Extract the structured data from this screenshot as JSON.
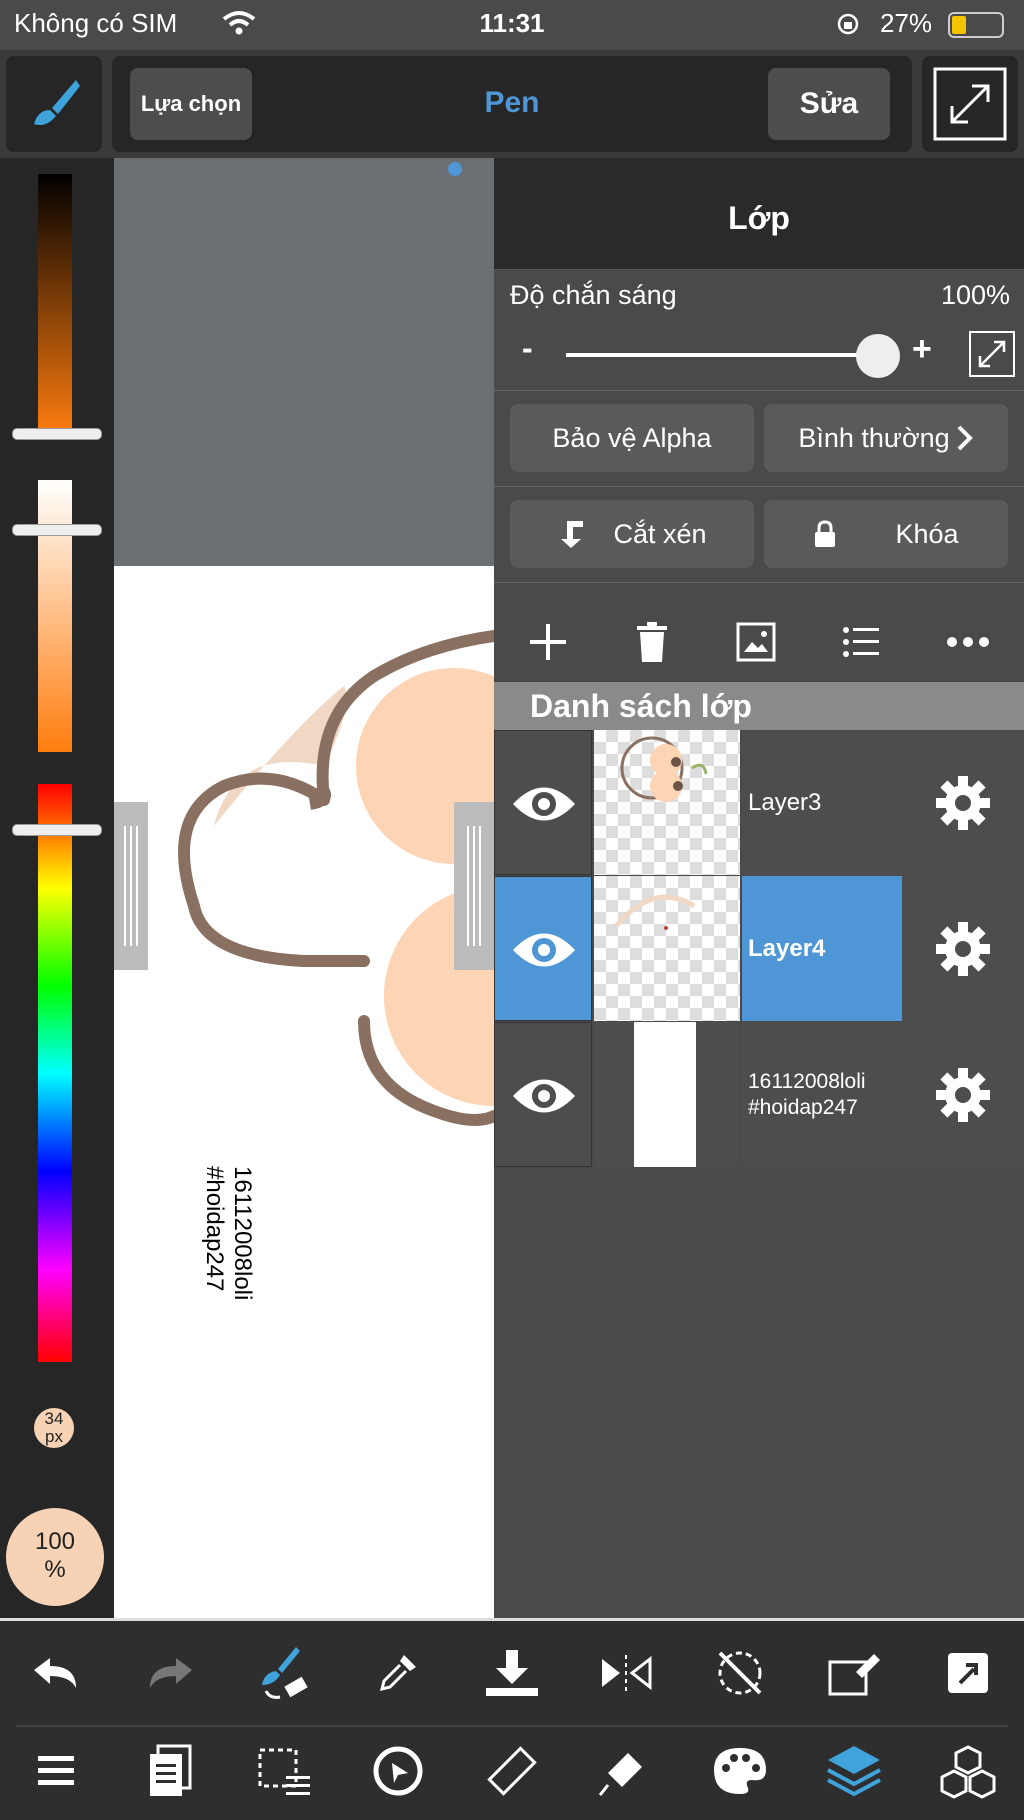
{
  "status": {
    "carrier": "Không có SIM",
    "time": "11:31",
    "battery": "27%"
  },
  "toolbar": {
    "select_label": "Lựa chọn",
    "tool_name": "Pen",
    "edit_label": "Sửa"
  },
  "left_panel": {
    "brush_size": "34\npx",
    "opacity": "100\n%"
  },
  "canvas": {
    "watermark_line1": "16112008loli",
    "watermark_line2": "#hoidap247"
  },
  "layers_panel": {
    "title": "Lớp",
    "opacity_label": "Độ chắn sáng",
    "opacity_value": "100%",
    "opacity_level": 1.0,
    "minus": "-",
    "plus": "+",
    "alpha_protect": "Bảo vệ Alpha",
    "blend_mode": "Bình thường",
    "clipping": "Cắt xén",
    "lock": "Khóa",
    "list_header": "Danh sách lớp",
    "layers": [
      {
        "name": "Layer3",
        "selected": false
      },
      {
        "name": "Layer4",
        "selected": true
      },
      {
        "name": "16112008loli\n#hoidap247",
        "selected": false
      }
    ]
  },
  "colors": {
    "accent": "#4f96d6",
    "skin": "#f7d2b4",
    "outline": "#8a7060",
    "panel": "#4a4a4a"
  }
}
